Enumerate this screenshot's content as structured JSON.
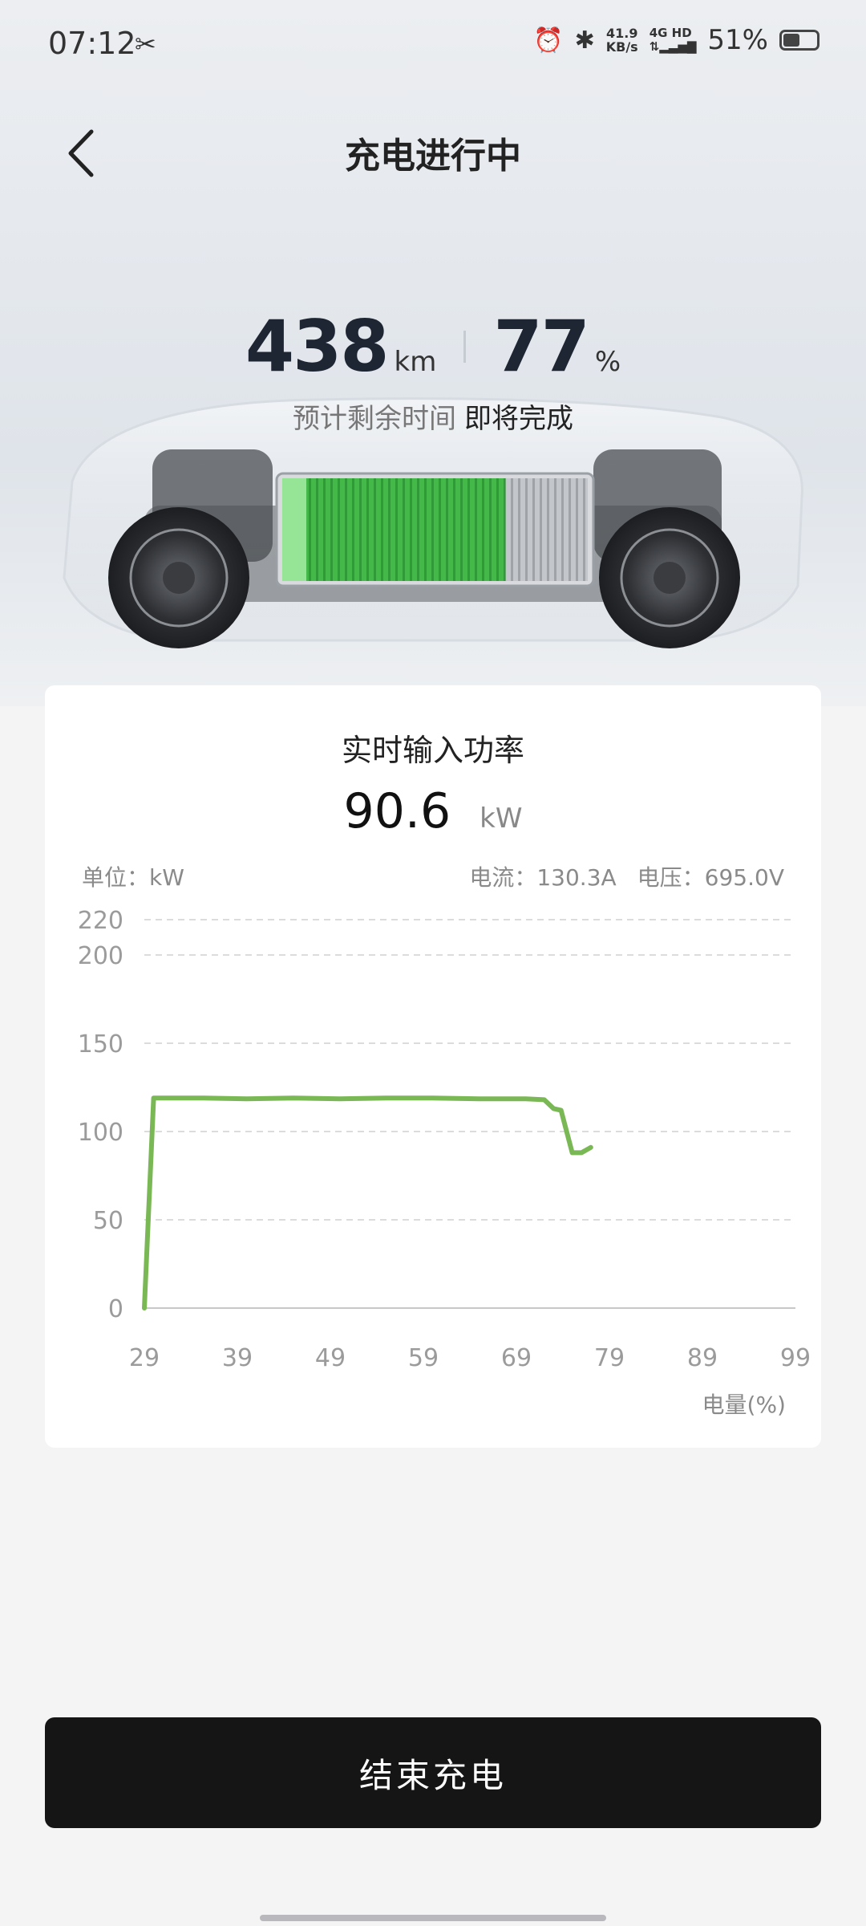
{
  "status_bar": {
    "time": "07:12",
    "left_icon": "scissors-icon",
    "speed_top": "41.9",
    "speed_bottom": "KB/s",
    "network_top": "4G HD",
    "network_bottom": "",
    "battery_percent": "51%",
    "battery_level": 0.51,
    "icons": [
      "alarm-icon",
      "bluetooth-icon",
      "signal-icon",
      "battery-icon"
    ]
  },
  "header": {
    "title": "充电进行中"
  },
  "stats": {
    "range_value": "438",
    "range_unit": "km",
    "soc_value": "77",
    "soc_unit": "%",
    "eta_label": "预计剩余时间",
    "eta_value": "即将完成"
  },
  "vehicle": {
    "battery_fill_fraction": 0.77,
    "colors": {
      "battery_green": "#3cb043",
      "battery_grey": "#b9bcc0"
    }
  },
  "card": {
    "title": "实时输入功率",
    "power_value": "90.6",
    "power_unit": "kW",
    "unit_label": "单位：kW",
    "current": "电流：130.3A",
    "voltage": "电压：695.0V"
  },
  "chart_data": {
    "type": "line",
    "title": "",
    "xlabel": "电量(%)",
    "ylabel": "",
    "xlim": [
      29,
      99
    ],
    "ylim": [
      0,
      220
    ],
    "x_ticks": [
      "29",
      "39",
      "49",
      "59",
      "69",
      "79",
      "89",
      "99"
    ],
    "y_ticks": [
      "0",
      "50",
      "100",
      "150",
      "200",
      "220"
    ],
    "grid": true,
    "series": [
      {
        "color": "#7ab856",
        "x": [
          29,
          30,
          35,
          40,
          45,
          50,
          55,
          60,
          65,
          70,
          72,
          73,
          73.8,
          75,
          76,
          77
        ],
        "y": [
          0,
          119,
          119,
          118.5,
          119,
          118.5,
          119,
          119,
          118.5,
          118.5,
          118,
          113,
          112,
          88,
          88,
          91
        ]
      }
    ]
  },
  "actions": {
    "end_charging_label": "结束充电"
  }
}
